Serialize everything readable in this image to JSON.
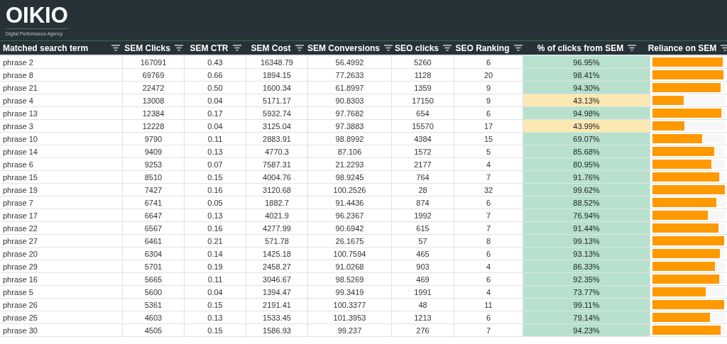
{
  "brand": {
    "logo": "OIKIO",
    "tagline": "Digital Performance Agency"
  },
  "table": {
    "columns": [
      "Matched search term",
      "SEM Clicks",
      "SEM CTR",
      "SEM Cost",
      "SEM Conversions",
      "SEO clicks",
      "SEO Ranking",
      "% of clicks from SEM",
      "Reliance on SEM"
    ],
    "rows": [
      {
        "cells": [
          "phrase 2",
          "167091",
          "0.43",
          "16348.79",
          "56.4992",
          "5260",
          "6",
          "96.95%"
        ],
        "color": "#b7e1cd",
        "level": 0.9695
      },
      {
        "cells": [
          "phrase 8",
          "69769",
          "0.66",
          "1894.15",
          "77.2633",
          "1128",
          "20",
          "98.41%"
        ],
        "color": "#b7e1cd",
        "level": 0.9841
      },
      {
        "cells": [
          "phrase 21",
          "22472",
          "0.50",
          "1600.34",
          "61.8997",
          "1359",
          "9",
          "94.30%"
        ],
        "color": "#b7e1cd",
        "level": 0.943
      },
      {
        "cells": [
          "phrase 4",
          "13008",
          "0.04",
          "5171.17",
          "90.8303",
          "17150",
          "9",
          "43.13%"
        ],
        "color": "#fce8b2",
        "level": 0.4313
      },
      {
        "cells": [
          "phrase 13",
          "12384",
          "0.17",
          "5932.74",
          "97.7682",
          "654",
          "6",
          "94.98%"
        ],
        "color": "#b7e1cd",
        "level": 0.9498
      },
      {
        "cells": [
          "phrase 3",
          "12228",
          "0.04",
          "3125.04",
          "97.3883",
          "15570",
          "17",
          "43.99%"
        ],
        "color": "#fce8b2",
        "level": 0.4399
      },
      {
        "cells": [
          "phrase 10",
          "9790",
          "0.11",
          "2883.91",
          "98.8992",
          "4384",
          "15",
          "69.07%"
        ],
        "color": "#b7e1cd",
        "level": 0.6907
      },
      {
        "cells": [
          "phrase 14",
          "9409",
          "0.13",
          "4770.3",
          "87.106",
          "1572",
          "5",
          "85.68%"
        ],
        "color": "#b7e1cd",
        "level": 0.8568
      },
      {
        "cells": [
          "phrase 6",
          "9253",
          "0.07",
          "7587.31",
          "21.2293",
          "2177",
          "4",
          "80.95%"
        ],
        "color": "#b7e1cd",
        "level": 0.8095
      },
      {
        "cells": [
          "phrase 15",
          "8510",
          "0.15",
          "4004.76",
          "98.9245",
          "764",
          "7",
          "91.76%"
        ],
        "color": "#b7e1cd",
        "level": 0.9176
      },
      {
        "cells": [
          "phrase 19",
          "7427",
          "0.16",
          "3120.68",
          "100.2526",
          "28",
          "32",
          "99.62%"
        ],
        "color": "#b7e1cd",
        "level": 0.9962
      },
      {
        "cells": [
          "phrase 7",
          "6741",
          "0.05",
          "1882.7",
          "91.4436",
          "874",
          "6",
          "88.52%"
        ],
        "color": "#b7e1cd",
        "level": 0.8852
      },
      {
        "cells": [
          "phrase 17",
          "6647",
          "0.13",
          "4021.9",
          "96.2367",
          "1992",
          "7",
          "76.94%"
        ],
        "color": "#b7e1cd",
        "level": 0.7694
      },
      {
        "cells": [
          "phrase 22",
          "6567",
          "0.16",
          "4277.99",
          "90.6942",
          "615",
          "7",
          "91.44%"
        ],
        "color": "#b7e1cd",
        "level": 0.9144
      },
      {
        "cells": [
          "phrase 27",
          "6461",
          "0.21",
          "571.78",
          "26.1675",
          "57",
          "8",
          "99.13%"
        ],
        "color": "#b7e1cd",
        "level": 0.9913
      },
      {
        "cells": [
          "phrase 20",
          "6304",
          "0.14",
          "1425.18",
          "100.7594",
          "465",
          "6",
          "93.13%"
        ],
        "color": "#b7e1cd",
        "level": 0.9313
      },
      {
        "cells": [
          "phrase 29",
          "5701",
          "0.19",
          "2458.27",
          "91.0268",
          "903",
          "4",
          "86.33%"
        ],
        "color": "#b7e1cd",
        "level": 0.8633
      },
      {
        "cells": [
          "phrase 16",
          "5665",
          "0.11",
          "3046.67",
          "98.5269",
          "469",
          "6",
          "92.35%"
        ],
        "color": "#b7e1cd",
        "level": 0.9235
      },
      {
        "cells": [
          "phrase 5",
          "5600",
          "0.04",
          "1394.47",
          "99.3419",
          "1991",
          "4",
          "73.77%"
        ],
        "color": "#b7e1cd",
        "level": 0.7377
      },
      {
        "cells": [
          "phrase 26",
          "5361",
          "0.15",
          "2191.41",
          "100.3377",
          "48",
          "11",
          "99.11%"
        ],
        "color": "#b7e1cd",
        "level": 0.9911
      },
      {
        "cells": [
          "phrase 25",
          "4603",
          "0.13",
          "1533.45",
          "101.3953",
          "1213",
          "6",
          "79.14%"
        ],
        "color": "#b7e1cd",
        "level": 0.7914
      },
      {
        "cells": [
          "phrase 30",
          "4505",
          "0.15",
          "1586.93",
          "99.237",
          "276",
          "7",
          "94.23%"
        ],
        "color": "#b7e1cd",
        "level": 0.9423
      }
    ]
  }
}
